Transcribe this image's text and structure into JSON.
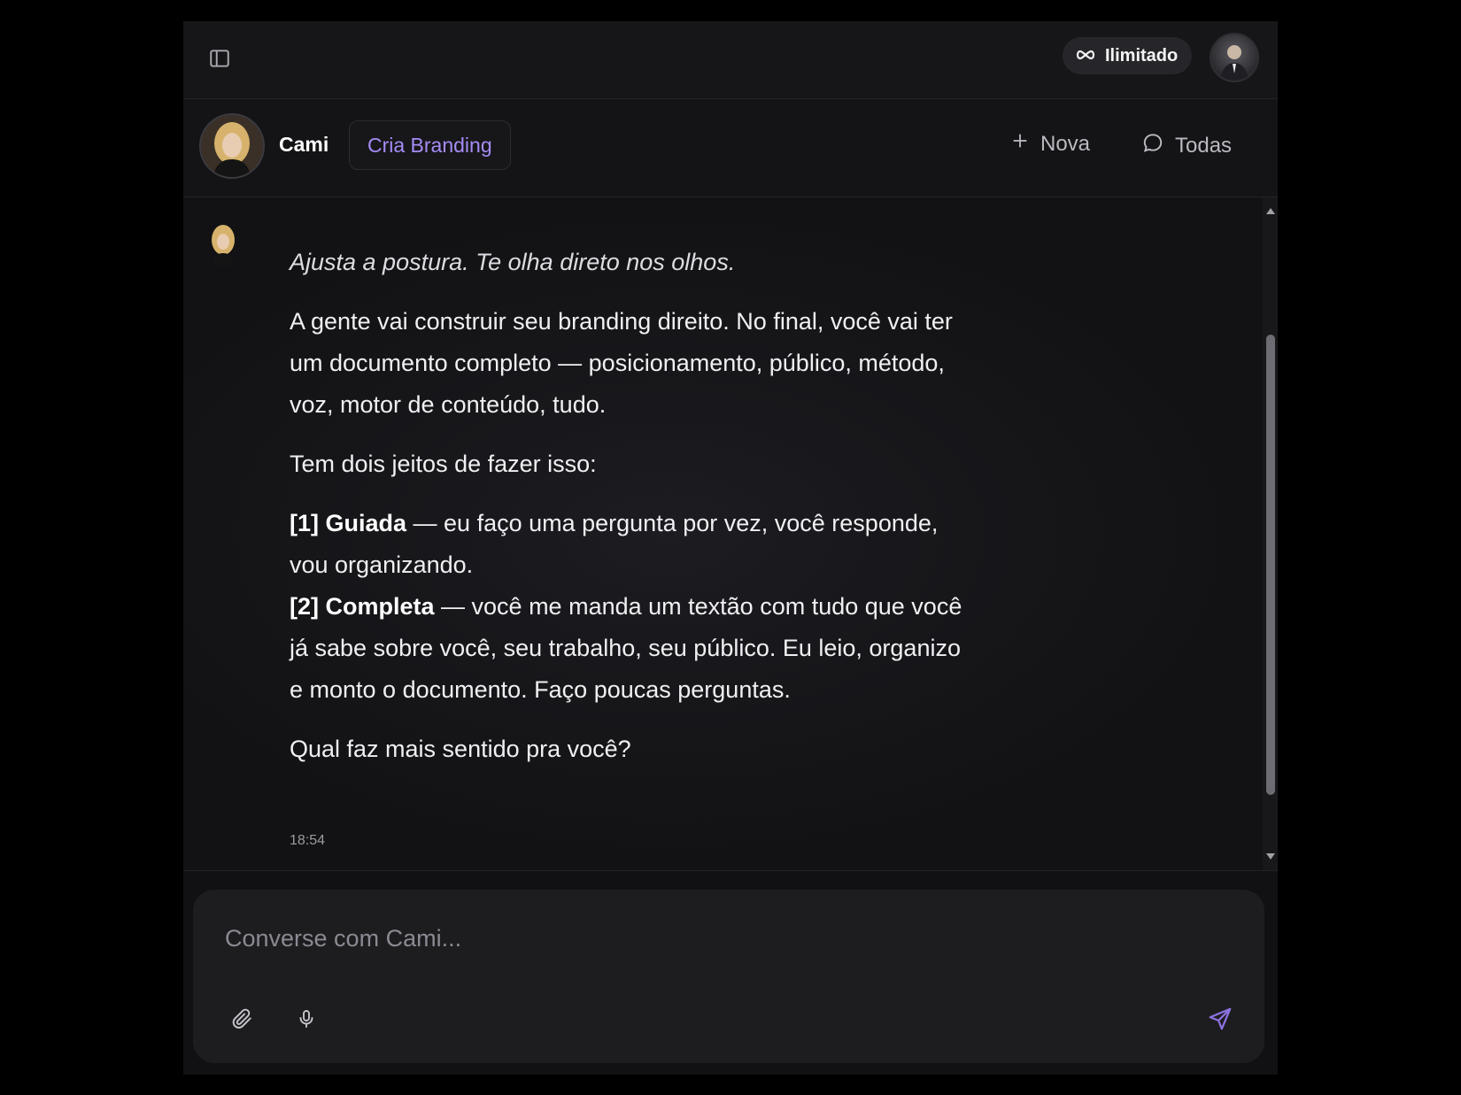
{
  "topbar": {
    "plan_label": "Ilimitado",
    "plan_icon": "infinity-icon",
    "sidebar_icon": "sidebar-toggle-icon",
    "user_avatar": "user-avatar"
  },
  "agent": {
    "name": "Cami",
    "pill_label": "Cria Branding",
    "accent_color": "#a68cf5"
  },
  "header_actions": {
    "new_label": "Nova",
    "new_icon": "plus-icon",
    "all_label": "Todas",
    "all_icon": "chat-bubble-icon"
  },
  "message": {
    "intro": "Ajusta a postura. Te olha direto nos olhos.",
    "para1": "A gente vai construir seu branding direito. No final, você vai ter um documento completo — posicionamento, público, método, voz, motor de conteúdo, tudo.",
    "para2": "Tem dois jeitos de fazer isso:",
    "opt1_label": "[1] Guiada",
    "opt1_text": " — eu faço uma pergunta por vez, você responde, vou organizando.",
    "opt2_label": "[2] Completa",
    "opt2_text": " — você me manda um textão com tudo que você já sabe sobre você, seu trabalho, seu público. Eu leio, organizo e monto o documento. Faço poucas perguntas.",
    "question": "Qual faz mais sentido pra você?",
    "time": "18:54"
  },
  "composer": {
    "placeholder": "Converse com Cami...",
    "attach_icon": "paperclip-icon",
    "mic_icon": "microphone-icon",
    "send_icon": "send-icon"
  }
}
